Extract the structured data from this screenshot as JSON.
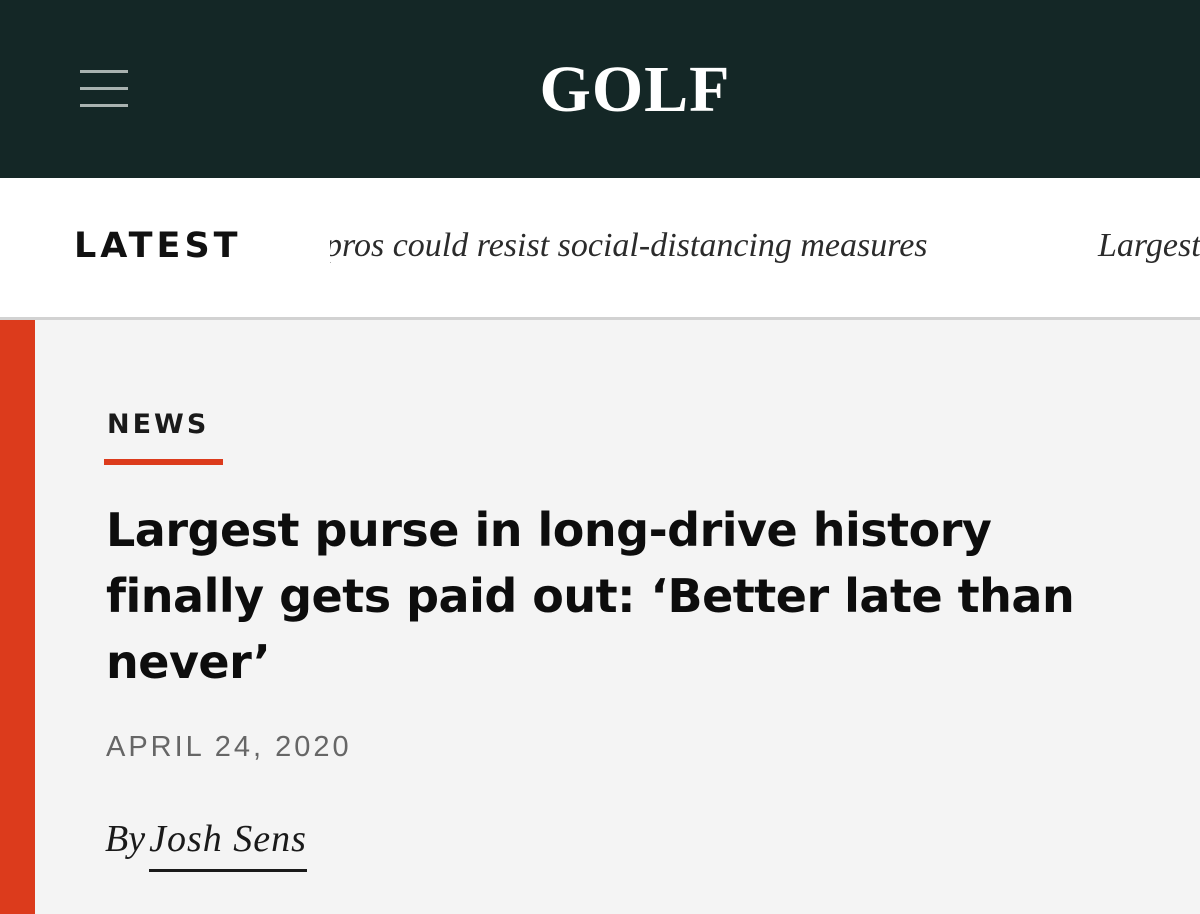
{
  "header": {
    "logo": "GOLF",
    "menu_icon": "hamburger-menu-icon"
  },
  "latest": {
    "label": "LATEST",
    "items": [
      "pros could resist social-distancing measures",
      "Largest"
    ]
  },
  "article": {
    "category": "NEWS",
    "headline": "Largest purse in long-drive history finally gets paid out: ‘Better late than never’",
    "date": "APRIL 24, 2020",
    "byline_prefix": "By",
    "author": "Josh Sens"
  },
  "colors": {
    "header_bg": "#142726",
    "accent": "#dc3b1c",
    "page_bg": "#f4f4f4"
  }
}
